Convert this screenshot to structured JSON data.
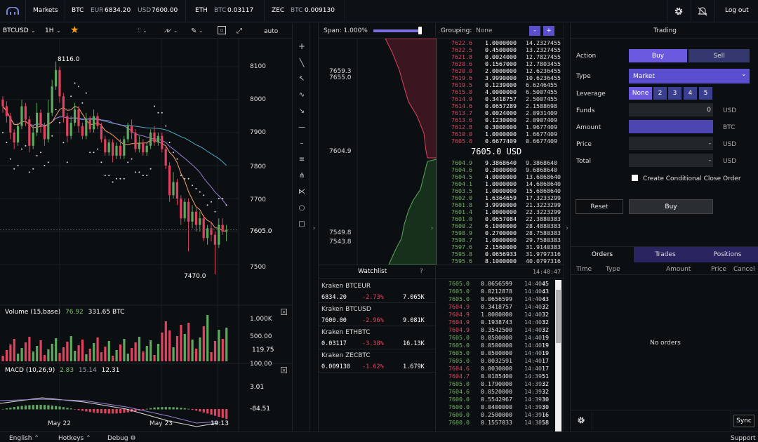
{
  "topbar": {
    "markets_label": "Markets",
    "tickers": [
      {
        "symbol": "BTC",
        "q1": "EUR",
        "v1": "6834.20",
        "q2": "USD",
        "v2": "7600.00"
      },
      {
        "symbol": "ETH",
        "q1": "BTC",
        "v1": "0.03117"
      },
      {
        "symbol": "ZEC",
        "q1": "BTC",
        "v1": "0.009130"
      }
    ],
    "logout_label": "Log out"
  },
  "chart": {
    "pair": "BTCUSD",
    "interval": "1H",
    "auto_label": "auto",
    "price_ticks": [
      "8100",
      "8000",
      "7900",
      "7800",
      "7700",
      "7605.0",
      "7500"
    ],
    "high_label": "8116.0",
    "low_label": "7470.0",
    "volume_title": "Volume (15,base)",
    "volume_v1": "76.92",
    "volume_v2": "331.65 BTC",
    "volume_ticks": [
      "1.000K",
      "500.00",
      "119.75"
    ],
    "macd_title": "MACD (10,26,9)",
    "macd_v1": "2.83",
    "macd_v2": "15.14",
    "macd_v3": "12.31",
    "macd_ticks": [
      "100.00",
      "3.01",
      "-84.51"
    ],
    "date_labels": [
      "May 22",
      "May 23",
      "19:13"
    ],
    "candles": [
      {
        "o": 8000,
        "c": 7980,
        "h": 8010,
        "l": 7960
      },
      {
        "o": 7980,
        "c": 7950,
        "h": 7995,
        "l": 7930
      },
      {
        "o": 7950,
        "c": 7900,
        "h": 7960,
        "l": 7880
      },
      {
        "o": 7900,
        "c": 7870,
        "h": 7910,
        "l": 7850
      },
      {
        "o": 7870,
        "c": 7920,
        "h": 7930,
        "l": 7860
      },
      {
        "o": 7920,
        "c": 7980,
        "h": 8000,
        "l": 7910
      },
      {
        "o": 7980,
        "c": 7940,
        "h": 7990,
        "l": 7920
      },
      {
        "o": 7940,
        "c": 7860,
        "h": 7950,
        "l": 7840
      },
      {
        "o": 7860,
        "c": 7900,
        "h": 7920,
        "l": 7850
      },
      {
        "o": 7900,
        "c": 7960,
        "h": 7990,
        "l": 7890
      },
      {
        "o": 7960,
        "c": 7920,
        "h": 7970,
        "l": 7900
      },
      {
        "o": 7920,
        "c": 7880,
        "h": 7930,
        "l": 7860
      },
      {
        "o": 7880,
        "c": 7960,
        "h": 8000,
        "l": 7870
      },
      {
        "o": 7960,
        "c": 8040,
        "h": 8060,
        "l": 7950
      },
      {
        "o": 8040,
        "c": 8090,
        "h": 8116,
        "l": 8030
      },
      {
        "o": 8090,
        "c": 8010,
        "h": 8100,
        "l": 7990
      },
      {
        "o": 8010,
        "c": 7950,
        "h": 8020,
        "l": 7930
      },
      {
        "o": 7950,
        "c": 7890,
        "h": 7960,
        "l": 7870
      },
      {
        "o": 7890,
        "c": 7930,
        "h": 7950,
        "l": 7880
      },
      {
        "o": 7930,
        "c": 7970,
        "h": 7990,
        "l": 7920
      },
      {
        "o": 7970,
        "c": 7920,
        "h": 7980,
        "l": 7900
      },
      {
        "o": 7920,
        "c": 7890,
        "h": 7930,
        "l": 7880
      },
      {
        "o": 7890,
        "c": 7940,
        "h": 7960,
        "l": 7880
      },
      {
        "o": 7940,
        "c": 7910,
        "h": 7950,
        "l": 7900
      },
      {
        "o": 7910,
        "c": 7950,
        "h": 7970,
        "l": 7900
      },
      {
        "o": 7950,
        "c": 7920,
        "h": 7960,
        "l": 7910
      },
      {
        "o": 7920,
        "c": 7880,
        "h": 7930,
        "l": 7870
      },
      {
        "o": 7880,
        "c": 7840,
        "h": 7890,
        "l": 7830
      },
      {
        "o": 7840,
        "c": 7870,
        "h": 7880,
        "l": 7830
      },
      {
        "o": 7870,
        "c": 7830,
        "h": 7880,
        "l": 7810
      },
      {
        "o": 7830,
        "c": 7860,
        "h": 7870,
        "l": 7820
      },
      {
        "o": 7860,
        "c": 7830,
        "h": 7880,
        "l": 7820
      },
      {
        "o": 7830,
        "c": 7880,
        "h": 7890,
        "l": 7820
      },
      {
        "o": 7880,
        "c": 7920,
        "h": 7930,
        "l": 7870
      },
      {
        "o": 7920,
        "c": 7900,
        "h": 7940,
        "l": 7880
      },
      {
        "o": 7900,
        "c": 7850,
        "h": 7910,
        "l": 7840
      },
      {
        "o": 7850,
        "c": 7870,
        "h": 7890,
        "l": 7840
      },
      {
        "o": 7870,
        "c": 7840,
        "h": 7880,
        "l": 7830
      },
      {
        "o": 7840,
        "c": 7860,
        "h": 7870,
        "l": 7830
      },
      {
        "o": 7860,
        "c": 7900,
        "h": 7910,
        "l": 7850
      },
      {
        "o": 7900,
        "c": 7870,
        "h": 7920,
        "l": 7860
      },
      {
        "o": 7870,
        "c": 7890,
        "h": 7900,
        "l": 7860
      },
      {
        "o": 7890,
        "c": 7850,
        "h": 7900,
        "l": 7840
      },
      {
        "o": 7850,
        "c": 7800,
        "h": 7860,
        "l": 7790
      },
      {
        "o": 7800,
        "c": 7710,
        "h": 7810,
        "l": 7690
      },
      {
        "o": 7710,
        "c": 7750,
        "h": 7780,
        "l": 7700
      },
      {
        "o": 7750,
        "c": 7700,
        "h": 7760,
        "l": 7680
      },
      {
        "o": 7700,
        "c": 7640,
        "h": 7710,
        "l": 7620
      },
      {
        "o": 7640,
        "c": 7690,
        "h": 7700,
        "l": 7630
      },
      {
        "o": 7690,
        "c": 7630,
        "h": 7700,
        "l": 7540
      },
      {
        "o": 7630,
        "c": 7660,
        "h": 7680,
        "l": 7610
      },
      {
        "o": 7660,
        "c": 7620,
        "h": 7670,
        "l": 7600
      },
      {
        "o": 7620,
        "c": 7640,
        "h": 7660,
        "l": 7600
      },
      {
        "o": 7640,
        "c": 7580,
        "h": 7650,
        "l": 7570
      },
      {
        "o": 7580,
        "c": 7610,
        "h": 7620,
        "l": 7560
      },
      {
        "o": 7610,
        "c": 7590,
        "h": 7630,
        "l": 7570
      },
      {
        "o": 7590,
        "c": 7560,
        "h": 7600,
        "l": 7470
      },
      {
        "o": 7560,
        "c": 7620,
        "h": 7640,
        "l": 7550
      },
      {
        "o": 7620,
        "c": 7600,
        "h": 7640,
        "l": 7590
      },
      {
        "o": 7600,
        "c": 7605,
        "h": 7620,
        "l": 7570
      }
    ]
  },
  "depth": {
    "span_label": "Span: 1.000%",
    "price_labels": [
      "7659.3",
      "7655.0",
      "7604.9",
      "7549.8",
      "7543.8"
    ]
  },
  "watchlist": {
    "title": "Watchlist",
    "help": "?",
    "items": [
      {
        "name": "Kraken BTCEUR",
        "price": "6834.20",
        "change": "-2.73%",
        "vol": "7.065K"
      },
      {
        "name": "Kraken BTCUSD",
        "price": "7600.00",
        "change": "-2.96%",
        "vol": "9.081K"
      },
      {
        "name": "Kraken ETHBTC",
        "price": "0.03117",
        "change": "-3.38%",
        "vol": "16.13K"
      },
      {
        "name": "Kraken ZECBTC",
        "price": "0.009130",
        "change": "-1.62%",
        "vol": "1.679K"
      }
    ]
  },
  "orderbook": {
    "grouping_label": "Grouping:",
    "grouping_value": "None",
    "mid_price": "7605.0 USD",
    "asks": [
      [
        "7622.6",
        "1.0000000",
        "14.2327455"
      ],
      [
        "7622.5",
        "0.4500000",
        "13.2327455"
      ],
      [
        "7621.8",
        "0.0024000",
        "12.7827455"
      ],
      [
        "7620.6",
        "0.1567000",
        "12.7803455"
      ],
      [
        "7620.0",
        "2.0000000",
        "12.6236455"
      ],
      [
        "7619.6",
        "3.9990000",
        "10.6236455"
      ],
      [
        "7619.5",
        "0.1239000",
        "6.6246455"
      ],
      [
        "7615.0",
        "4.0000000",
        "6.5007455"
      ],
      [
        "7614.9",
        "0.3418757",
        "2.5007455"
      ],
      [
        "7614.6",
        "0.0657289",
        "2.1588698"
      ],
      [
        "7613.7",
        "0.0024000",
        "2.0931409"
      ],
      [
        "7613.6",
        "0.1230000",
        "2.0907409"
      ],
      [
        "7612.8",
        "0.3000000",
        "1.9677409"
      ],
      [
        "7610.0",
        "1.0000000",
        "1.6677409"
      ],
      [
        "7605.0",
        "0.6677409",
        "0.6677409"
      ]
    ],
    "bids": [
      [
        "7604.9",
        "9.3868640",
        "9.3868640"
      ],
      [
        "7604.6",
        "0.3000000",
        "9.6868640"
      ],
      [
        "7604.5",
        "4.0000000",
        "13.6868640"
      ],
      [
        "7604.1",
        "1.0000000",
        "14.6868640"
      ],
      [
        "7603.5",
        "1.0000000",
        "15.6868640"
      ],
      [
        "7602.0",
        "1.6364659",
        "17.3233299"
      ],
      [
        "7601.8",
        "3.9990000",
        "21.3223299"
      ],
      [
        "7601.4",
        "1.0000000",
        "22.3223299"
      ],
      [
        "7601.0",
        "0.0657084",
        "22.3880383"
      ],
      [
        "7600.2",
        "6.1000000",
        "28.4880383"
      ],
      [
        "7598.9",
        "0.2700000",
        "28.7580383"
      ],
      [
        "7598.7",
        "1.0000000",
        "29.7580383"
      ],
      [
        "7597.6",
        "2.1560000",
        "31.9140383"
      ],
      [
        "7595.8",
        "0.0656933",
        "31.9797316"
      ],
      [
        "7595.6",
        "8.1000000",
        "40.0797316"
      ]
    ]
  },
  "trades": {
    "header_time": "14:40:47",
    "rows": [
      [
        "7605.0",
        "0.0656599",
        "14:40:",
        "45",
        "g"
      ],
      [
        "7605.0",
        "0.0212878",
        "14:40:",
        "43",
        "g"
      ],
      [
        "7605.0",
        "0.0656599",
        "14:40:",
        "43",
        "g"
      ],
      [
        "7604.9",
        "0.3418757",
        "14:40:",
        "32",
        "r"
      ],
      [
        "7604.9",
        "1.0000000",
        "14:40:",
        "32",
        "r"
      ],
      [
        "7604.9",
        "0.1938743",
        "14:40:",
        "32",
        "r"
      ],
      [
        "7604.9",
        "0.3542500",
        "14:40:",
        "32",
        "r"
      ],
      [
        "7605.0",
        "0.0500000",
        "14:40:",
        "19",
        "g"
      ],
      [
        "7605.0",
        "0.0500000",
        "14:40:",
        "19",
        "g"
      ],
      [
        "7605.0",
        "0.0500000",
        "14:40:",
        "19",
        "g"
      ],
      [
        "7605.0",
        "0.0032591",
        "14:40:",
        "17",
        "g"
      ],
      [
        "7604.6",
        "0.0030000",
        "14:40:",
        "17",
        "r"
      ],
      [
        "7604.7",
        "0.0185400",
        "14:39:",
        "51",
        "r"
      ],
      [
        "7605.0",
        "0.1790000",
        "14:39:",
        "32",
        "g"
      ],
      [
        "7604.6",
        "0.0520000",
        "14:39:",
        "32",
        "g"
      ],
      [
        "7600.0",
        "0.5542967",
        "14:39:",
        "30",
        "g"
      ],
      [
        "7600.0",
        "0.0400000",
        "14:39:",
        "30",
        "g"
      ],
      [
        "7600.0",
        "0.2500000",
        "14:39:",
        "16",
        "g"
      ],
      [
        "7600.0",
        "0.1557033",
        "14:38:",
        "58",
        "g"
      ]
    ]
  },
  "trading": {
    "title": "Trading",
    "action_label": "Action",
    "buy_tab": "Buy",
    "sell_tab": "Sell",
    "type_label": "Type",
    "type_value": "Market",
    "leverage_label": "Leverage",
    "leverage_options": [
      "None",
      "2",
      "3",
      "4",
      "5"
    ],
    "funds_label": "Funds",
    "funds_value": "0",
    "funds_unit": "USD",
    "amount_label": "Amount",
    "amount_unit": "BTC",
    "price_label": "Price",
    "price_value": "-",
    "price_unit": "USD",
    "total_label": "Total",
    "total_value": "-",
    "total_unit": "USD",
    "conditional_label": "Create Conditional Close Order",
    "reset_label": "Reset",
    "submit_label": "Buy"
  },
  "orders": {
    "tabs": [
      "Orders",
      "Trades",
      "Positions"
    ],
    "columns": [
      "Time",
      "Type",
      "Amount",
      "Price",
      "Cancel"
    ],
    "empty_text": "No orders",
    "sync_label": "Sync"
  },
  "footer": {
    "language": "English",
    "hotkeys": "Hotkeys",
    "debug": "Debug",
    "support": "Support"
  }
}
